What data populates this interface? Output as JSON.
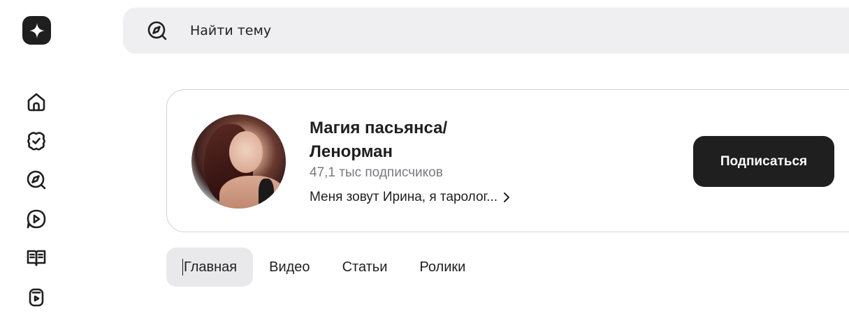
{
  "sidebar": {
    "logo": "sparkle-logo-icon",
    "items": [
      {
        "icon": "home-icon"
      },
      {
        "icon": "subscriptions-icon"
      },
      {
        "icon": "compass-icon"
      },
      {
        "icon": "video-play-icon"
      },
      {
        "icon": "articles-book-icon"
      },
      {
        "icon": "shorts-icon"
      }
    ]
  },
  "search": {
    "placeholder": "Найти тему",
    "icon": "compass-search-icon"
  },
  "channel": {
    "title_line1": "Магия пасьянса/",
    "title_line2": "Ленорман",
    "subscribers": "47,1 тыс подписчиков",
    "description": "Меня зовут Ирина, я таролог...",
    "subscribe_label": "Подписаться"
  },
  "tabs": [
    {
      "label": "Главная",
      "active": true
    },
    {
      "label": "Видео",
      "active": false
    },
    {
      "label": "Статьи",
      "active": false
    },
    {
      "label": "Ролики",
      "active": false
    }
  ],
  "colors": {
    "accent": "#1f1f1f",
    "search_bg": "#efeff2",
    "tab_active_bg": "#e9e9ec",
    "muted_text": "#7a7a7e"
  }
}
